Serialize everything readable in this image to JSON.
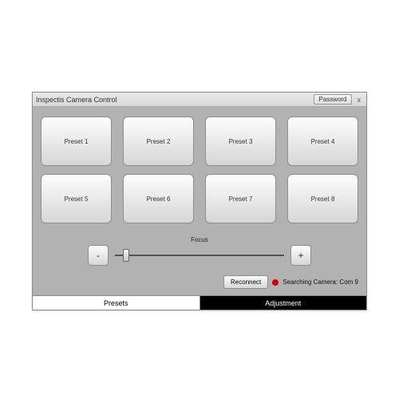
{
  "window": {
    "title": "Inspectis Camera Control",
    "password_btn": "Password",
    "close_glyph": "x"
  },
  "presets": [
    "Preset 1",
    "Preset 2",
    "Preset 3",
    "Preset 4",
    "Preset 5",
    "Preset 6",
    "Preset 7",
    "Preset 8"
  ],
  "focus": {
    "label": "Focus",
    "minus": "-",
    "plus": "+",
    "value": 5,
    "min": 0,
    "max": 100
  },
  "status": {
    "reconnect": "Reconnect",
    "text": "Searching Camera: Com 9",
    "color": "#d40000"
  },
  "tabs": {
    "presets": "Presets",
    "adjustment": "Adjustment"
  }
}
